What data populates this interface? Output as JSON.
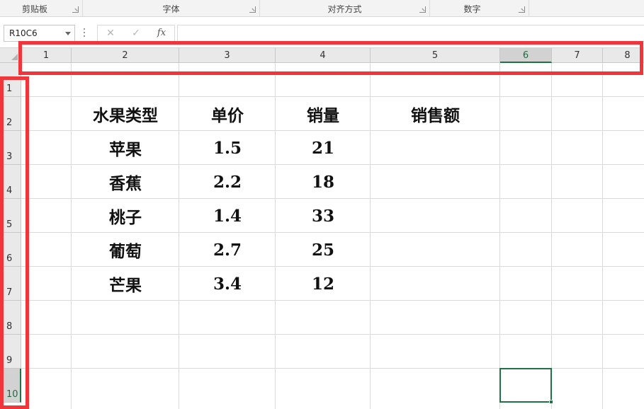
{
  "ribbon": {
    "groups": [
      {
        "label": "剪贴板"
      },
      {
        "label": "字体"
      },
      {
        "label": "对齐方式"
      },
      {
        "label": "数字"
      }
    ]
  },
  "formula_bar": {
    "name_box": "R10C6",
    "cancel_symbol": "✕",
    "enter_symbol": "✓",
    "fx_symbol": "fx",
    "formula_value": ""
  },
  "sheet": {
    "column_headers": [
      "1",
      "2",
      "3",
      "4",
      "5",
      "6",
      "7",
      "8"
    ],
    "row_headers": [
      "1",
      "2",
      "3",
      "4",
      "5",
      "6",
      "7",
      "8",
      "9",
      "10"
    ],
    "selected_column": "6",
    "selected_row": "10",
    "table": {
      "headers": [
        "水果类型",
        "单价",
        "销量",
        "销售额"
      ],
      "rows": [
        [
          "苹果",
          "1.5",
          "21",
          ""
        ],
        [
          "香蕉",
          "2.2",
          "18",
          ""
        ],
        [
          "桃子",
          "1.4",
          "33",
          ""
        ],
        [
          "葡萄",
          "2.7",
          "25",
          ""
        ],
        [
          "芒果",
          "3.4",
          "12",
          ""
        ]
      ]
    }
  },
  "colors": {
    "accent": "#217346",
    "annotation": "#f0363b"
  }
}
